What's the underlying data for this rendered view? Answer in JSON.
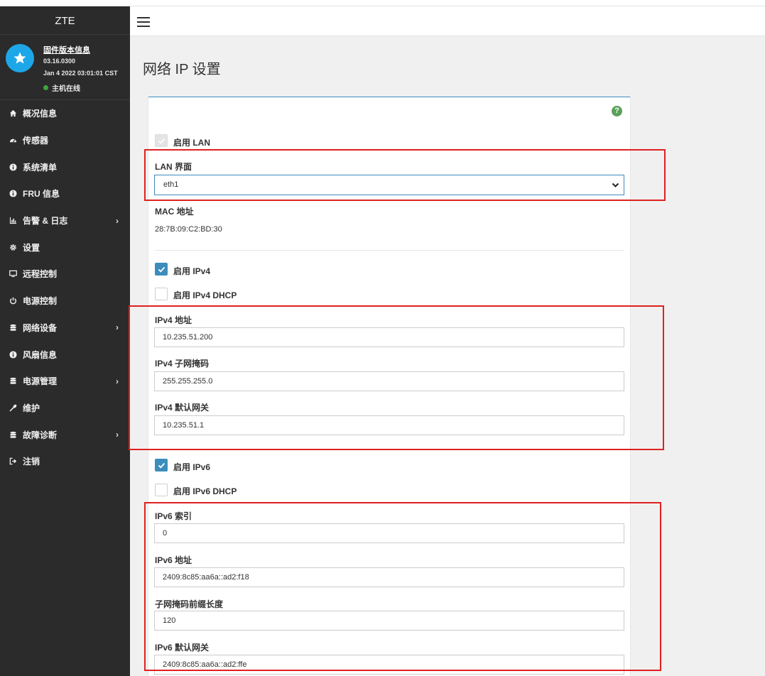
{
  "app": {
    "brand": "ZTE",
    "firmware_title": "固件版本信息",
    "firmware_version": "03.16.0300",
    "firmware_date": "Jan 4 2022 03:01:01 CST",
    "host_status": "主机在线",
    "status_color": "#3fa53f",
    "accent_color": "#3c8dbc",
    "highlight_color": "#e02020"
  },
  "sidebar": {
    "items": [
      {
        "label": "概况信息",
        "icon": "home-icon",
        "has_submenu": false
      },
      {
        "label": "传感器",
        "icon": "gauge-icon",
        "has_submenu": false
      },
      {
        "label": "系统清单",
        "icon": "info-icon",
        "has_submenu": false
      },
      {
        "label": "FRU 信息",
        "icon": "info-icon",
        "has_submenu": false
      },
      {
        "label": "告警 & 日志",
        "icon": "bar-chart-icon",
        "has_submenu": true
      },
      {
        "label": "设置",
        "icon": "gear-icon",
        "has_submenu": false
      },
      {
        "label": "远程控制",
        "icon": "monitor-icon",
        "has_submenu": false
      },
      {
        "label": "电源控制",
        "icon": "power-icon",
        "has_submenu": false
      },
      {
        "label": "网络设备",
        "icon": "database-icon",
        "has_submenu": true
      },
      {
        "label": "风扇信息",
        "icon": "info-icon",
        "has_submenu": false
      },
      {
        "label": "电源管理",
        "icon": "database-icon",
        "has_submenu": true
      },
      {
        "label": "维护",
        "icon": "wrench-icon",
        "has_submenu": false
      },
      {
        "label": "故障诊断",
        "icon": "database-icon",
        "has_submenu": true
      },
      {
        "label": "注销",
        "icon": "sign-out-icon",
        "has_submenu": false
      }
    ]
  },
  "page": {
    "title": "网络 IP 设置"
  },
  "form": {
    "enable_lan": {
      "label": "启用 LAN",
      "checked": true,
      "disabled": true
    },
    "lan_interface": {
      "label": "LAN 界面",
      "value": "eth1"
    },
    "mac": {
      "label": "MAC 地址",
      "value": "28:7B:09:C2:BD:30"
    },
    "enable_ipv4": {
      "label": "启用 IPv4",
      "checked": true
    },
    "enable_ipv4_dhcp": {
      "label": "启用 IPv4 DHCP",
      "checked": false
    },
    "ipv4_address": {
      "label": "IPv4 地址",
      "value": "10.235.51.200"
    },
    "ipv4_subnet": {
      "label": "IPv4 子网掩码",
      "value": "255.255.255.0"
    },
    "ipv4_gateway": {
      "label": "IPv4 默认网关",
      "value": "10.235.51.1"
    },
    "enable_ipv6": {
      "label": "启用 IPv6",
      "checked": true
    },
    "enable_ipv6_dhcp": {
      "label": "启用 IPv6 DHCP",
      "checked": false
    },
    "ipv6_index": {
      "label": "IPv6 索引",
      "value": "0"
    },
    "ipv6_address": {
      "label": "IPv6 地址",
      "value": "2409:8c85:aa6a::ad2:f18"
    },
    "ipv6_prefix": {
      "label": "子网掩码前缀长度",
      "value": "120"
    },
    "ipv6_gateway": {
      "label": "IPv6 默认网关",
      "value": "2409:8c85:aa6a::ad2:ffe"
    }
  }
}
